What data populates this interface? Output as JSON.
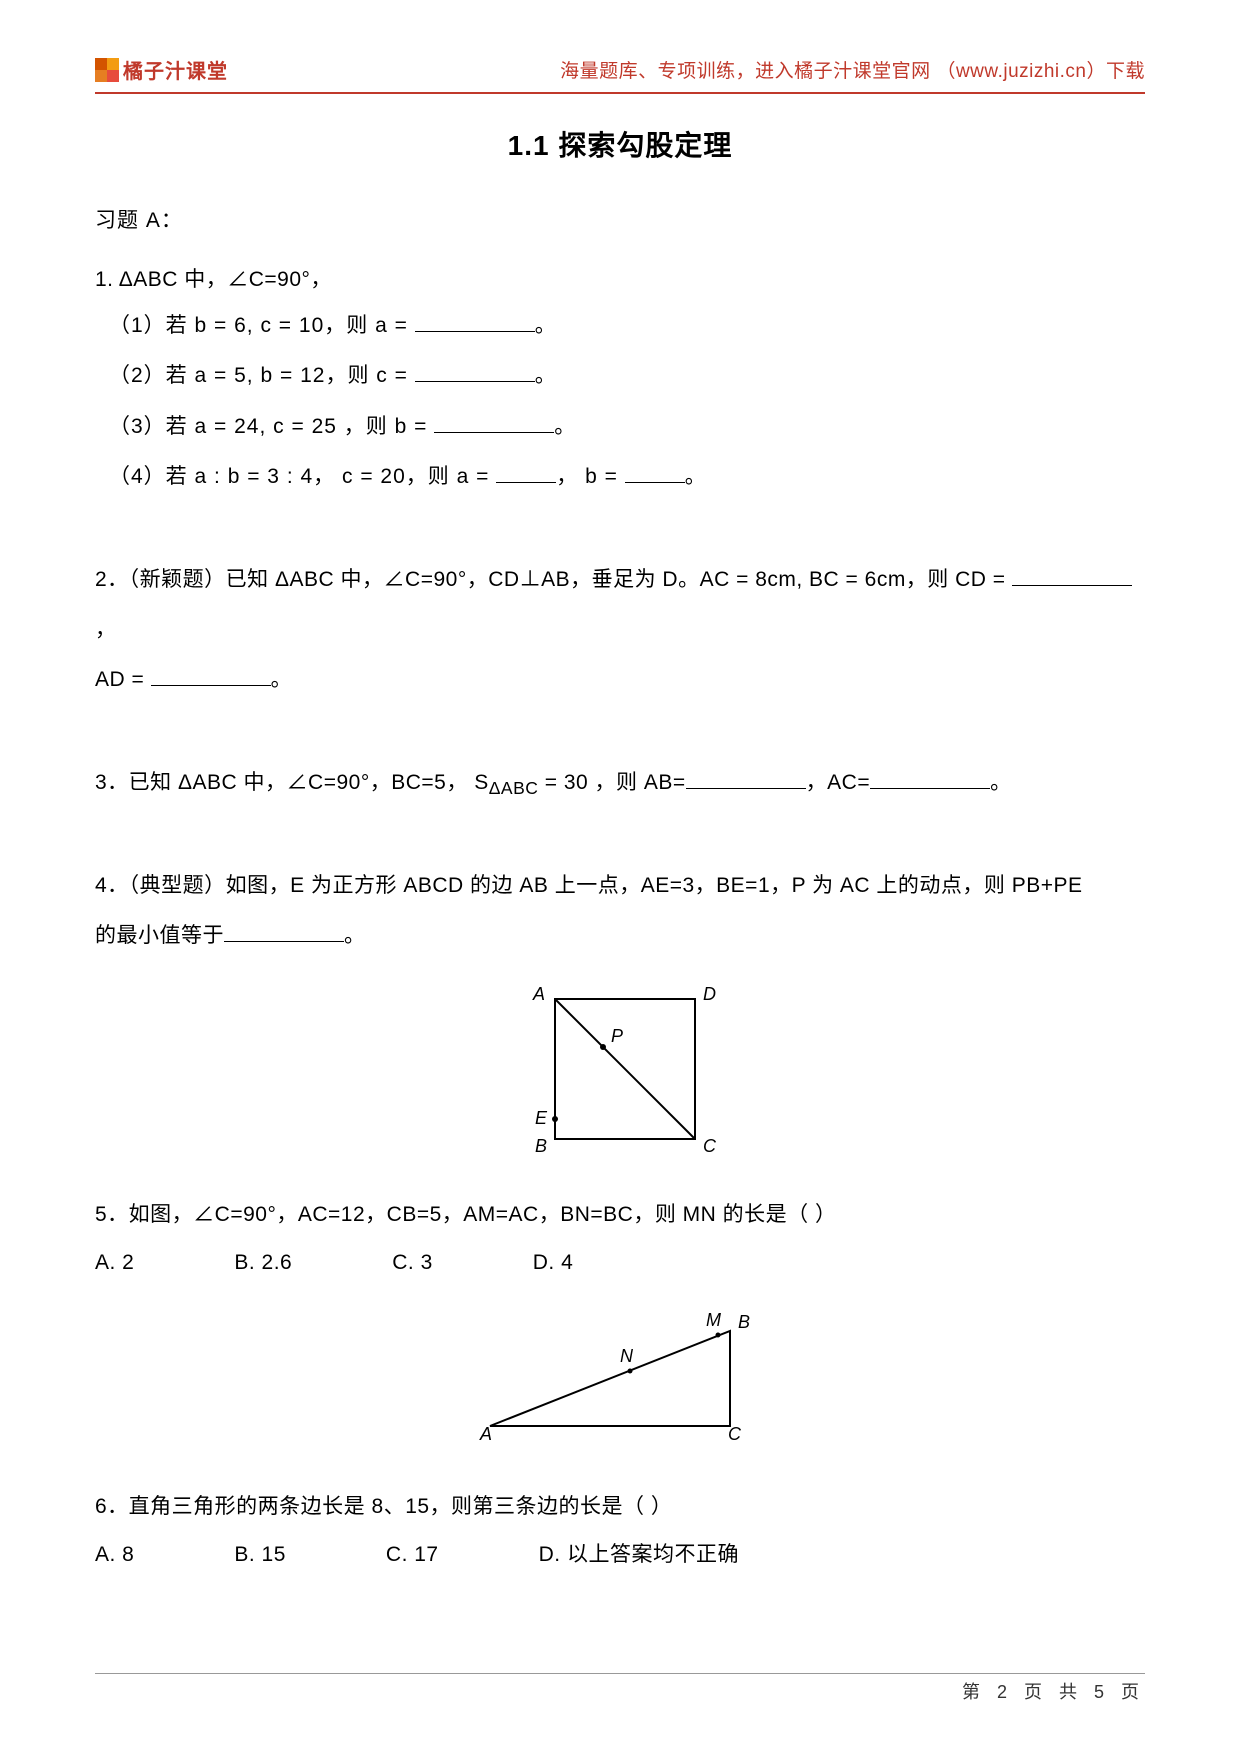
{
  "header": {
    "brand": "橘子汁课堂",
    "promo": "海量题库、专项训练，进入橘子汁课堂官网 （www.juzizhi.cn）下载"
  },
  "title": "1.1 探索勾股定理",
  "sectionLabel": "习题 A：",
  "q1": {
    "stem": "1.  ΔABC 中，∠C=90°，",
    "p1_pre": "（1）若 b = 6, c = 10，则 a = ",
    "p1_post": "。",
    "p2_pre": "（2）若 a = 5, b = 12，则 c = ",
    "p2_post": "。",
    "p3_pre": "（3）若 a = 24, c = 25 ，则 b = ",
    "p3_post": "。",
    "p4_pre": "（4）若 a : b = 3 : 4， c = 20，则 a = ",
    "p4_mid": "， b = ",
    "p4_post": "。"
  },
  "q2": {
    "pre": "2．（新颖题）已知 ΔABC 中，∠C=90°，CD⊥AB，垂足为 D。AC = 8cm, BC = 6cm，则 CD = ",
    "mid": "，",
    "line2_pre": "AD = ",
    "line2_post": "。"
  },
  "q3": {
    "pre": "3．已知 ΔABC 中，∠C=90°，BC=5， S",
    "sub": "ΔABC",
    "mid1": " = 30 ，则 AB=",
    "mid2": "，AC=",
    "post": "。"
  },
  "q4": {
    "line1": "4．（典型题）如图，E 为正方形 ABCD 的边 AB 上一点，AE=3，BE=1，P 为 AC 上的动点，则 PB+PE",
    "line2_pre": "的最小值等于",
    "line2_post": "。",
    "labels": {
      "A": "A",
      "B": "B",
      "C": "C",
      "D": "D",
      "E": "E",
      "P": "P"
    }
  },
  "q5": {
    "stem": "5．如图，∠C=90°，AC=12，CB=5，AM=AC，BN=BC，则 MN 的长是（     ）",
    "optA": "A. 2",
    "optB": "B. 2.6",
    "optC": "C. 3",
    "optD": "D. 4",
    "labels": {
      "A": "A",
      "B": "B",
      "C": "C",
      "M": "M",
      "N": "N"
    }
  },
  "q6": {
    "stem": "6．直角三角形的两条边长是 8、15，则第三条边的长是（     ）",
    "optA": "A. 8",
    "optB": "B. 15",
    "optC": "C. 17",
    "optD": "D.  以上答案均不正确"
  },
  "footer": {
    "pageInfo": "第 2 页 共 5 页"
  }
}
